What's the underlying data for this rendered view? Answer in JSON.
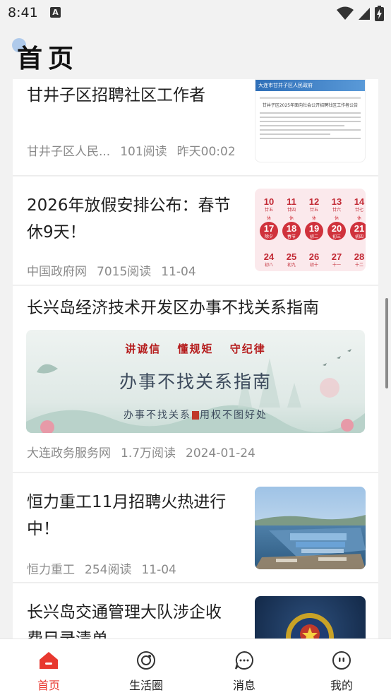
{
  "status_bar": {
    "time": "8:41",
    "notification_icon": "A"
  },
  "header": {
    "title": "首页"
  },
  "feed": [
    {
      "title": "甘井子区招聘社区工作者",
      "source": "甘井子区人民...",
      "reads": "101阅读",
      "time": "昨天00:02",
      "thumb": "document-screenshot"
    },
    {
      "title": "2026年放假安排公布：春节休9天！",
      "title_line1": "2026年放假安排公布：春节",
      "title_line2": "休9天！",
      "source": "中国政府网",
      "reads": "7015阅读",
      "time": "11-04",
      "thumb": "calendar"
    },
    {
      "title": "长兴岛经济技术开发区办事不找关系指南",
      "source": "大连政务服务网",
      "reads": "1.7万阅读",
      "time": "2024-01-24",
      "thumb": "banner"
    },
    {
      "title": "恒力重工11月招聘火热进行中！",
      "title_line1": "恒力重工11月招聘火热进行",
      "title_line2": "中！",
      "source": "恒力重工",
      "reads": "254阅读",
      "time": "11-04",
      "thumb": "aerial-photo"
    },
    {
      "title": "长兴岛交通管理大队涉企收费目录清单",
      "title_line1": "长兴岛交通管理大队涉企收",
      "title_line2": "费目录清单",
      "thumb": "police-emblem"
    }
  ],
  "doc_thumb": {
    "header_text": "大连市甘井子区人民政府",
    "doc_title": "甘井子区2025年面向社会公开招聘社区工作者公告"
  },
  "calendar_thumb": {
    "rows": [
      [
        {
          "d": "10",
          "s": "廿五"
        },
        {
          "d": "11",
          "s": "廿四"
        },
        {
          "d": "12",
          "s": "廿五"
        },
        {
          "d": "13",
          "s": "廿六"
        },
        {
          "d": "14",
          "s": "廿七"
        }
      ],
      [
        {
          "d": "17",
          "s": "除夕"
        },
        {
          "d": "18",
          "s": "春节"
        },
        {
          "d": "19",
          "s": "初二"
        },
        {
          "d": "20",
          "s": "初三"
        },
        {
          "d": "21",
          "s": "初四"
        }
      ],
      [
        {
          "d": "24",
          "s": "初八"
        },
        {
          "d": "25",
          "s": "初九"
        },
        {
          "d": "26",
          "s": "初十"
        },
        {
          "d": "27",
          "s": "十一"
        },
        {
          "d": "28",
          "s": "十二"
        }
      ]
    ],
    "badge": "休"
  },
  "banner": {
    "seals": [
      "讲诚信",
      "懂规矩",
      "守纪律"
    ],
    "headline": "办事不找关系指南",
    "subline_a": "办事不找关系",
    "subline_b": "用权不图好处"
  },
  "tabs": [
    {
      "label": "首页",
      "icon": "home-icon",
      "active": true
    },
    {
      "label": "生活圈",
      "icon": "circle-icon",
      "active": false
    },
    {
      "label": "消息",
      "icon": "message-icon",
      "active": false
    },
    {
      "label": "我的",
      "icon": "profile-icon",
      "active": false
    }
  ],
  "colors": {
    "accent": "#e8382f",
    "background": "#f2f2f2"
  }
}
